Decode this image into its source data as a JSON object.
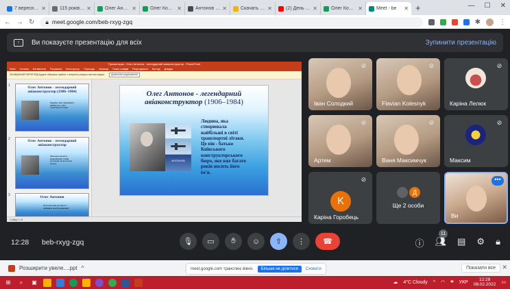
{
  "browser": {
    "tabs": [
      {
        "label": "7 вересня день",
        "color": "#1a73e8",
        "active": false
      },
      {
        "label": "115 років з дн",
        "color": "#6b6b6b",
        "active": false
      },
      {
        "label": "Олег Антонов",
        "color": "#0f9d58",
        "active": false
      },
      {
        "label": "Олег Костянт",
        "color": "#0f9d58",
        "active": false
      },
      {
        "label": "Антонов Оле",
        "color": "#4a4a4a",
        "active": false
      },
      {
        "label": "Скачать през",
        "color": "#f4b400",
        "active": false
      },
      {
        "label": "(2) День в іст",
        "color": "#ff0000",
        "active": false
      },
      {
        "label": "Олег Костян",
        "color": "#0f9d58",
        "active": false
      },
      {
        "label": "Meet - be",
        "color": "#00897b",
        "active": true
      }
    ],
    "new_tab": "+",
    "url": "meet.google.com/beb-rxyg-zgq"
  },
  "banner": {
    "text": "Ви показуєте презентацію для всіх",
    "stop": "Зупинити презентацію"
  },
  "ppt": {
    "window_title": "Презентація - Олег Антонов - легендарний авіаконструктор - PowerPoint",
    "ribbon": [
      "Файл",
      "Головна",
      "Вставлення",
      "Рисування",
      "Конструктор",
      "Переходи",
      "Анімація",
      "Показ слайдів",
      "Рецензування",
      "Вигляд",
      "Довідка"
    ],
    "notice": "ЗАХИЩЕНИЙ ПЕРЕГЛЯД Будьте обережні: файли з Інтернету можуть містити віруси.",
    "notice_button": "Дозволити редагування",
    "status": "Слайд 1 з 8"
  },
  "thumbnails": [
    {
      "num": "1",
      "title": "Олег Антонов - легендарний авіаконструктор (1906–1984)",
      "text": "Людина, яка створювала найбільші у світі транспортні літаки."
    },
    {
      "num": "2",
      "title": "Олег Антонов - легендарний авіаконструктор",
      "text": "Загальна кількість модифікацій літаків Антонова сягає кількох сотень."
    },
    {
      "num": "3",
      "title": "Олег Антонов",
      "text": "Олег Антонов усе життя займався конструюванням."
    }
  ],
  "slide": {
    "title": "Олег Антонов - легендарний авіаконструктор",
    "years": "(1906–1984)",
    "text": "Людина, яка\nстворювала\nнайбільші в світі\nтранспортні літаки.\nЦе він - батько\nКиївського\nконструкторського\nбюро, яке вже багато\nроків носить його\nім'я.",
    "logo_text": "АНТОНОВ"
  },
  "participants": [
    {
      "name": "Іван Солодкий",
      "muted": true
    },
    {
      "name": "Flavian Kolesnyk",
      "muted": true
    },
    {
      "name": "Каріна Лелюк",
      "muted": true
    },
    {
      "name": "Артем",
      "muted": true
    },
    {
      "name": "Ваня Максимчук",
      "muted": true
    },
    {
      "name": "Максим",
      "muted": true
    },
    {
      "name": "Каріна Горобець",
      "letter": "K",
      "muted": true
    },
    {
      "name": "Ще 2 особи",
      "letter2": "Д"
    },
    {
      "name": "Ви"
    }
  ],
  "meeting": {
    "time": "12:28",
    "code": "beb-rxyg-zgq",
    "participant_count": "11"
  },
  "downloads": {
    "file": "Розширити увеле....ppt",
    "show_all": "Показати все"
  },
  "share_notice": {
    "text": "meet.google.com транслює вікно.",
    "stop": "Більше не ділитися",
    "hide": "Сховати"
  },
  "taskbar": {
    "weather": "4°C  Cloudy",
    "lang": "УКР",
    "time": "12:28",
    "date": "08.02.2022"
  },
  "colors": {
    "meet_bg": "#202124",
    "accent_blue": "#8ab4f8",
    "leave_red": "#ea4335",
    "taskbar": "#bc1e2c",
    "ppt_red": "#c43e1c"
  }
}
